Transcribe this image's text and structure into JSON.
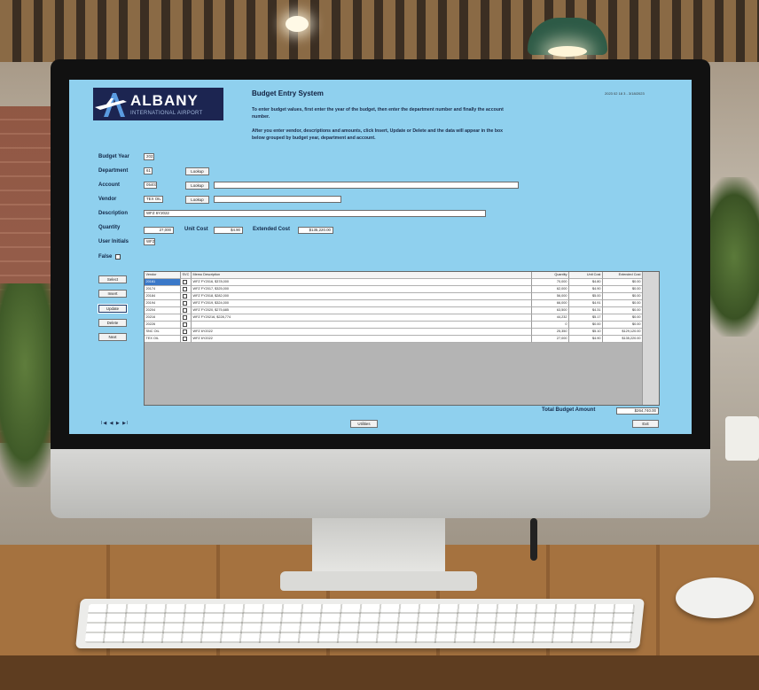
{
  "app": {
    "logo_name": "ALBANY",
    "logo_sub": "INTERNATIONAL AIRPORT",
    "title": "Budget Entry System",
    "datestamp": "2023 02 18 3 - 3/18/2023",
    "instructions_1": "To enter budget values, first enter the year of the budget, then enter the department number and finally the account number.",
    "instructions_2": "After you enter vendor, descriptions and amounts, click Insert, Update or Delete and the data will appear in the box below grouped by budget year, department and account."
  },
  "form": {
    "budget_year_label": "Budget Year",
    "budget_year": "2023",
    "department_label": "Department",
    "department": "61",
    "account_label": "Account",
    "account": "05401",
    "vendor_label": "Vendor",
    "vendor": "TEX OIL",
    "description_label": "Description",
    "description": "WFZ 6Y2022",
    "quantity_label": "Quantity",
    "quantity": "27,000",
    "unit_cost_label": "Unit Cost",
    "unit_cost": "$4.90",
    "extended_cost_label": "Extended Cost",
    "extended_cost": "$135,220.00",
    "user_initials_label": "User Initials",
    "user_initials": "WFZ",
    "false_label": "False",
    "lookup_label": "Lookup"
  },
  "side_buttons": {
    "select": "Select",
    "insert": "Insert",
    "update": "Update",
    "delete": "Delete",
    "next": "Next"
  },
  "grid": {
    "columns": [
      "Vendor",
      "SVC",
      "Memo Description",
      "Quantity",
      "Unit Cost",
      "Extended Cost"
    ],
    "rows": [
      {
        "vendor": "20161",
        "memo": "WFZ FY2016,   $378,000",
        "qty": "70,000",
        "unit": "$4.80",
        "ext": "$0.00"
      },
      {
        "vendor": "20174",
        "memo": "WFZ FY2017,   $325,000",
        "qty": "62,000",
        "unit": "$4.90",
        "ext": "$0.00"
      },
      {
        "vendor": "20184",
        "memo": "WFZ FY2018,   $282,000",
        "qty": "56,000",
        "unit": "$5.00",
        "ext": "$0.00"
      },
      {
        "vendor": "20194",
        "memo": "WFZ FY2019,   $324,000",
        "qty": "66,000",
        "unit": "$4.91",
        "ext": "$0.00"
      },
      {
        "vendor": "20204",
        "memo": "WFZ FY2020,   $275,685",
        "qty": "63,500",
        "unit": "$4.31",
        "ext": "$0.00"
      },
      {
        "vendor": "20216",
        "memo": "WFZ FY20216, $228,774",
        "qty": "44,232",
        "unit": "$5.17",
        "ext": "$0.00"
      },
      {
        "vendor": "20226",
        "memo": "",
        "qty": "0",
        "unit": "$0.00",
        "ext": "$0.00"
      },
      {
        "vendor": "SNC OIL",
        "memo": "WFZ 6Y2022",
        "qty": "25,350",
        "unit": "$5.10",
        "ext": "$129,120.00"
      },
      {
        "vendor": "TEX OIL",
        "memo": "WFZ 6Y2022",
        "qty": "27,000",
        "unit": "$4.90",
        "ext": "$135,220.00"
      }
    ]
  },
  "footer": {
    "total_label": "Total Budget Amount",
    "total_value": "$264,740.00",
    "utilities": "Utilities",
    "exit": "Exit",
    "nav": "I◀ ◀ ▶ ▶I"
  },
  "colors": {
    "screen_bg": "#8fd0ee",
    "logo_bg": "#1c2551",
    "selected_row": "#3a78c8"
  }
}
